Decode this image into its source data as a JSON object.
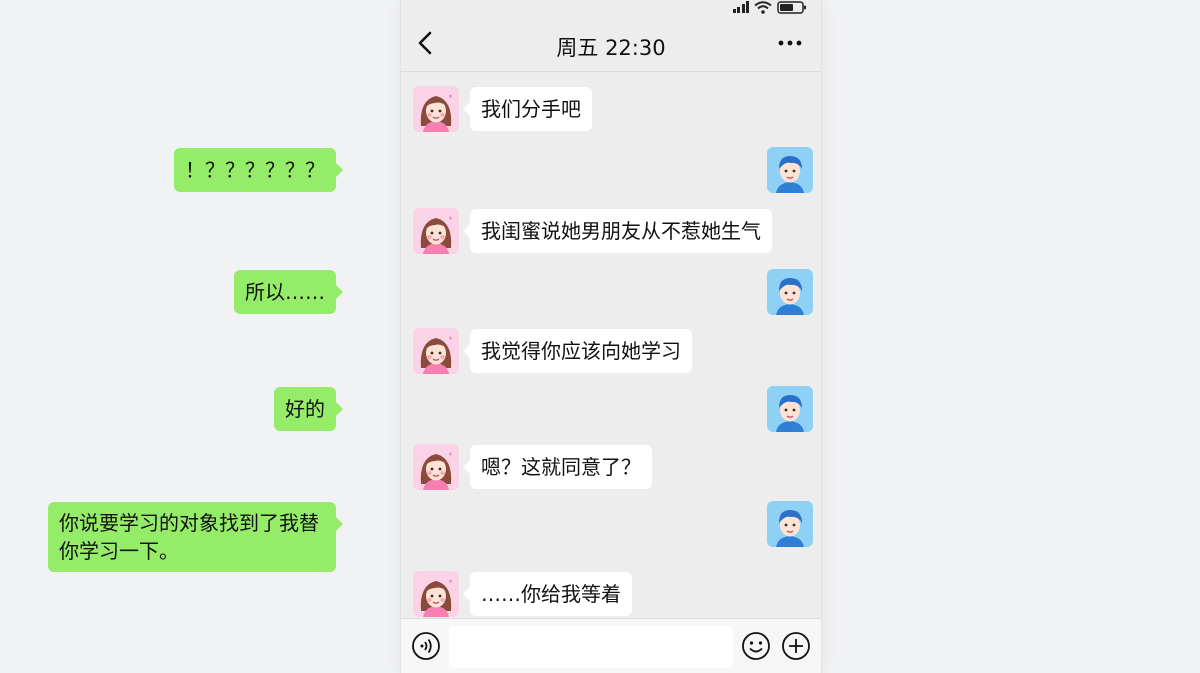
{
  "nav": {
    "title": "周五 22:30",
    "back_icon": "chevron-left-icon",
    "more_icon": "more-dots-icon"
  },
  "status_bar": {
    "icons": [
      "signal-icon",
      "wifi-icon",
      "battery-icon"
    ]
  },
  "colors": {
    "chat_background": "#ededed",
    "sent_bubble": "#95ec69",
    "received_bubble": "#ffffff",
    "female_avatar_bg": "#fbd3e6",
    "male_avatar_bg": "#8fd0f5"
  },
  "messages": [
    {
      "sender": "girlfriend",
      "side": "left",
      "text": "我们分手吧"
    },
    {
      "sender": "me",
      "side": "right",
      "text": "！？？？？？？"
    },
    {
      "sender": "girlfriend",
      "side": "left",
      "text": "我闺蜜说她男朋友从不惹她生气"
    },
    {
      "sender": "me",
      "side": "right",
      "text": "所以……"
    },
    {
      "sender": "girlfriend",
      "side": "left",
      "text": "我觉得你应该向她学习"
    },
    {
      "sender": "me",
      "side": "right",
      "text": "好的"
    },
    {
      "sender": "girlfriend",
      "side": "left",
      "text": "嗯？这就同意了？"
    },
    {
      "sender": "me",
      "side": "right",
      "text": "你说要学习的对象找到了我替你学习一下。"
    },
    {
      "sender": "girlfriend",
      "side": "left",
      "text": "……你给我等着"
    }
  ],
  "input_bar": {
    "value": "",
    "icons": [
      "voice-icon",
      "emoji-icon",
      "plus-icon"
    ]
  }
}
